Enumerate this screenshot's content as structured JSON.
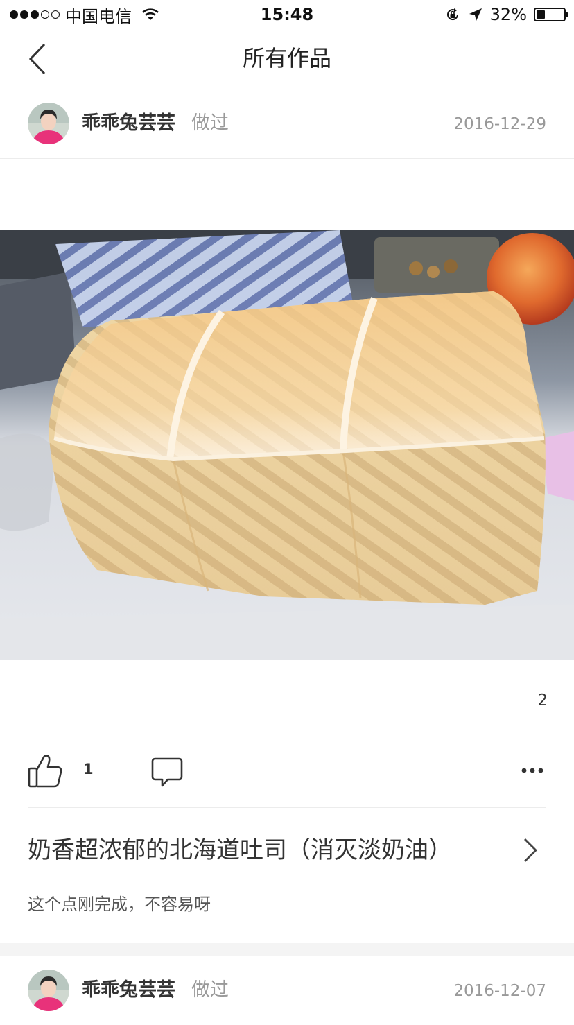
{
  "status_bar": {
    "carrier": "中国电信",
    "time": "15:48",
    "battery": "32%",
    "battery_fraction": 0.32,
    "signal_bars_filled": 3,
    "signal_bars_total": 5,
    "icons": [
      "wifi-icon",
      "orientation-lock-icon",
      "location-arrow-icon",
      "battery-icon"
    ]
  },
  "nav": {
    "back_icon": "chevron-left-icon",
    "title": "所有作品"
  },
  "posts": [
    {
      "user": "乖乖兔芸芸",
      "action": "做过",
      "date": "2016-12-29",
      "photo_page": "2",
      "likes": "1",
      "recipe_title": "奶香超浓郁的北海道吐司（消灭淡奶油）",
      "description": "这个点刚完成，不容易呀"
    },
    {
      "user": "乖乖兔芸芸",
      "action": "做过",
      "date": "2016-12-07"
    }
  ],
  "colors": {
    "primary_text": "#333333",
    "secondary_text": "#999999",
    "divider": "#ececec",
    "avatar_shirt": "#e8327a"
  }
}
